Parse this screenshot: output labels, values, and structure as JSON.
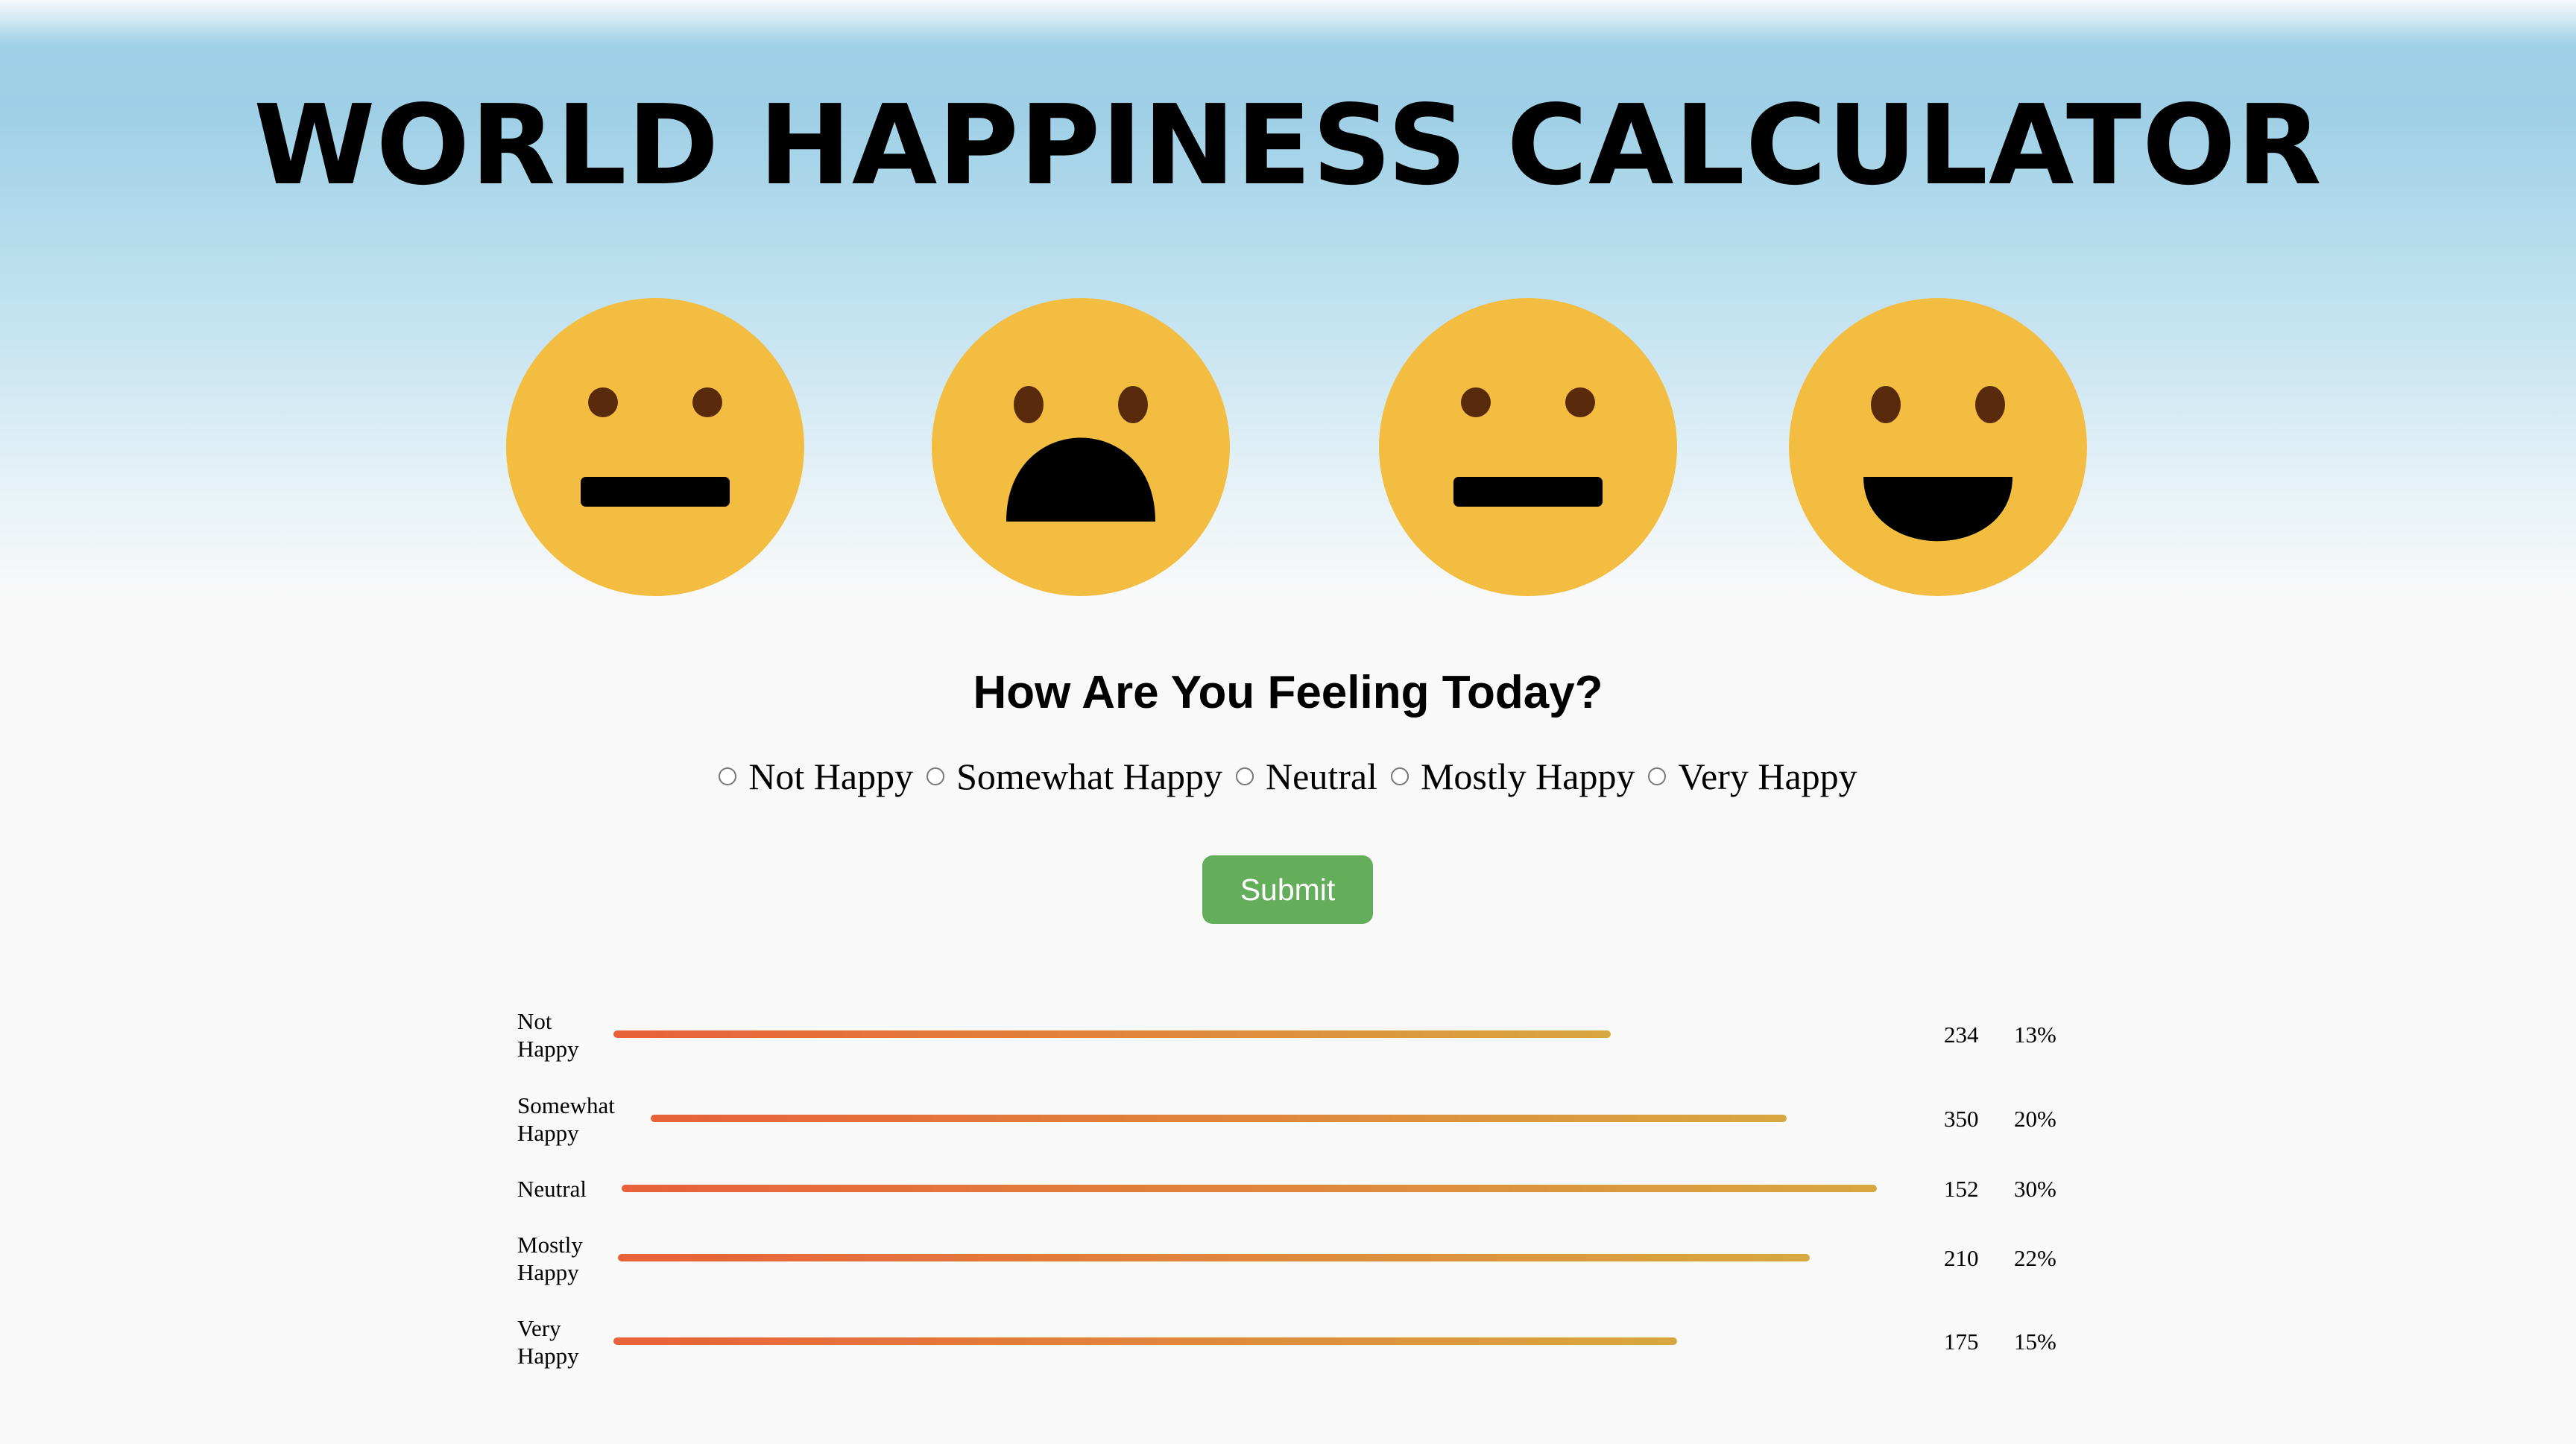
{
  "header": {
    "title": "WORLD HAPPINESS CALCULATOR"
  },
  "faces": [
    {
      "icon": "neutral-face-icon",
      "expression": "neutral"
    },
    {
      "icon": "unhappy-face-icon",
      "expression": "frown"
    },
    {
      "icon": "neutral-face-icon",
      "expression": "neutral"
    },
    {
      "icon": "happy-face-icon",
      "expression": "smile"
    }
  ],
  "colors": {
    "face_fill": "#f2bd40",
    "eye_fill": "#5a2a0c",
    "mouth_fill": "#000000",
    "submit_bg": "#64ad5b",
    "bar_start": "#e8613a",
    "bar_end": "#d8a840",
    "sky_top": "#9ecfe6"
  },
  "survey": {
    "question": "How Are You Feeling Today?",
    "options": [
      "Not Happy",
      "Somewhat Happy",
      "Neutral",
      "Mostly Happy",
      "Very Happy"
    ],
    "submit_label": "Submit"
  },
  "results": [
    {
      "label_line1": "Not",
      "label_line2": "Happy",
      "count": "234",
      "percent": "13%"
    },
    {
      "label_line1": "Somewhat",
      "label_line2": "Happy",
      "count": "350",
      "percent": "20%"
    },
    {
      "label_line1": "Neutral",
      "label_line2": "",
      "count": "152",
      "percent": "30%"
    },
    {
      "label_line1": "Mostly",
      "label_line2": "Happy",
      "count": "210",
      "percent": "22%"
    },
    {
      "label_line1": "Very",
      "label_line2": "Happy",
      "count": "175",
      "percent": "15%"
    }
  ]
}
